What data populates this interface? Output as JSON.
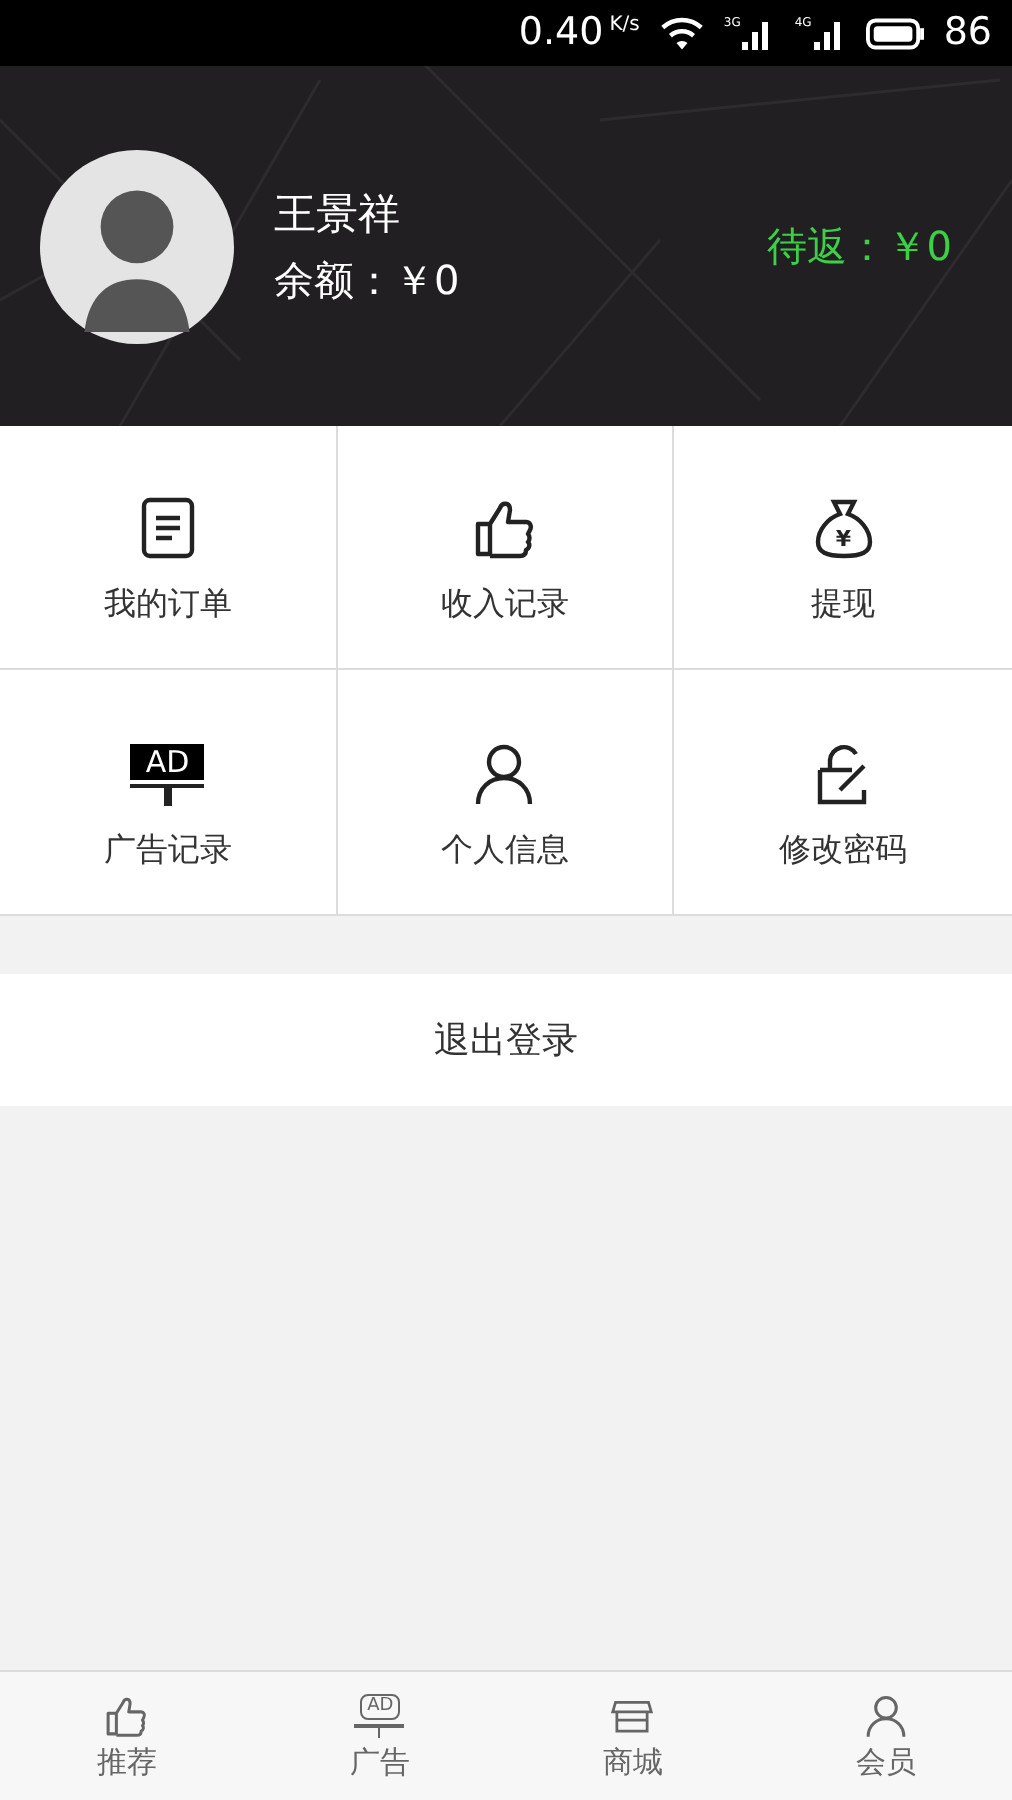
{
  "status_bar": {
    "speed": "0.40",
    "speed_unit": "K/s",
    "network_1": "3G",
    "network_2": "4G",
    "battery": "86"
  },
  "profile": {
    "name": "王景祥",
    "balance": "余额：￥0",
    "pending": "待返：￥0"
  },
  "menu": [
    {
      "kind": "document",
      "label": "我的订单"
    },
    {
      "kind": "thumb",
      "label": "收入记录"
    },
    {
      "kind": "moneybag",
      "label": "提现",
      "icon_text": "¥"
    },
    {
      "kind": "ad",
      "label": "广告记录",
      "icon_text": "AD"
    },
    {
      "kind": "person",
      "label": "个人信息"
    },
    {
      "kind": "lock",
      "label": "修改密码"
    }
  ],
  "logout": "退出登录",
  "tab_bar": [
    {
      "kind": "thumb",
      "label": "推荐"
    },
    {
      "kind": "ad",
      "label": "广告",
      "icon_text": "AD"
    },
    {
      "kind": "shop",
      "label": "商城"
    },
    {
      "kind": "person",
      "label": "会员"
    }
  ]
}
